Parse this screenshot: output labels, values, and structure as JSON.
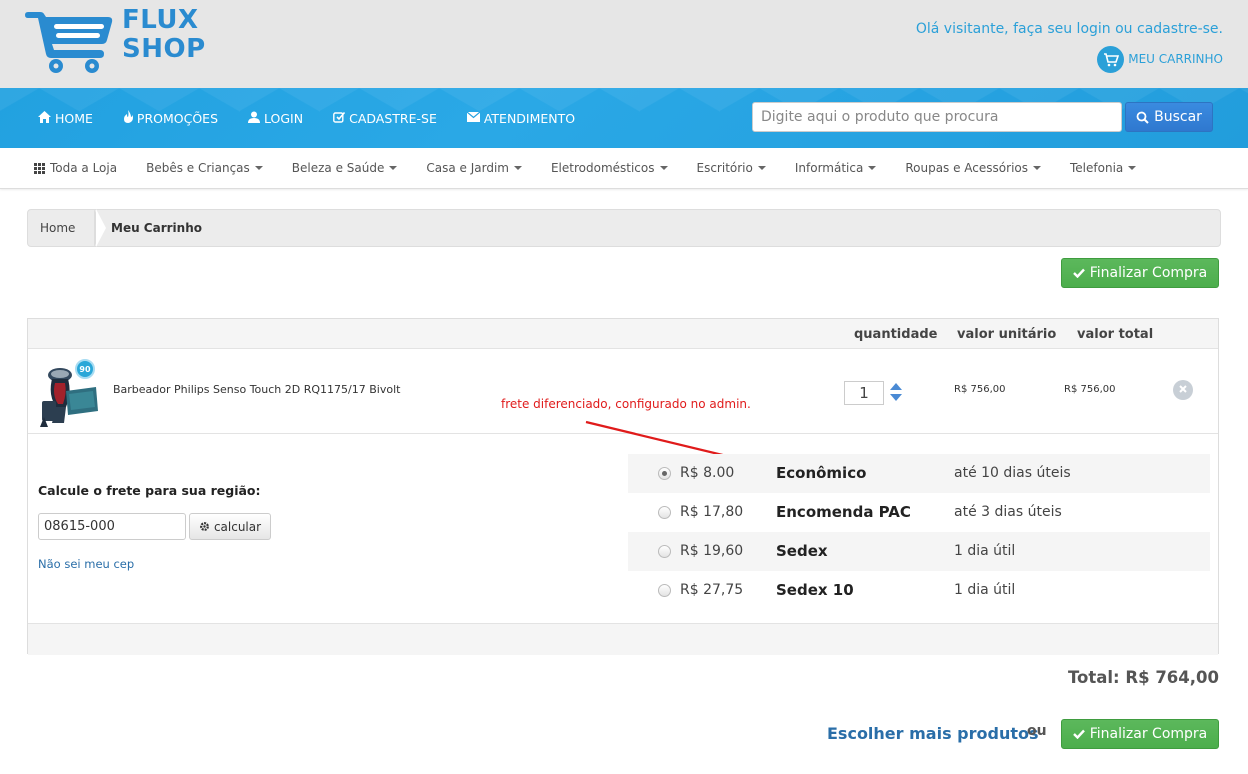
{
  "brand": {
    "line1": "FLUX",
    "line2": "SHOP",
    "color": "#2a8bd0"
  },
  "header": {
    "welcome": "Olá visitante, faça seu login ou cadastre-se.",
    "my_cart": "MEU CARRINHO"
  },
  "nav": {
    "items": [
      {
        "label": "HOME",
        "icon": "home-icon"
      },
      {
        "label": "PROMOÇÕES",
        "icon": "fire-icon"
      },
      {
        "label": "LOGIN",
        "icon": "user-icon"
      },
      {
        "label": "CADASTRE-SE",
        "icon": "edit-icon"
      },
      {
        "label": "ATENDIMENTO",
        "icon": "envelope-icon"
      }
    ],
    "search_placeholder": "Digite aqui o produto que procura",
    "search_button": "Buscar"
  },
  "categories": [
    "Toda a Loja",
    "Bebês e Crianças",
    "Beleza e Saúde",
    "Casa e Jardim",
    "Eletrodomésticos",
    "Escritório",
    "Informática",
    "Roupas e Acessórios",
    "Telefonia"
  ],
  "breadcrumb": {
    "home": "Home",
    "current": "Meu Carrinho"
  },
  "actions": {
    "checkout": "Finalizar Compra",
    "more_products": "Escolher mais produtos",
    "or": "ou"
  },
  "cart": {
    "columns": {
      "quantity": "quantidade",
      "unit_price": "valor unitário",
      "total_price": "valor total"
    },
    "product": {
      "name": "Barbeador Philips Senso Touch 2D RQ1175/17 Bivolt",
      "badge": "90",
      "quantity": "1",
      "unit_price": "R$ 756,00",
      "total_price": "R$ 756,00"
    },
    "annotation": "frete diferenciado, configurado no admin.",
    "shipping": {
      "label": "Calcule o frete para sua região:",
      "cep": "08615-000",
      "calc_button": "calcular",
      "no_cep": "Não sei meu cep",
      "options": [
        {
          "price": "R$ 8.00",
          "name": "Econômico",
          "time": "até 10 dias úteis",
          "selected": true
        },
        {
          "price": "R$ 17,80",
          "name": "Encomenda PAC",
          "time": "até 3 dias úteis",
          "selected": false
        },
        {
          "price": "R$ 19,60",
          "name": "Sedex",
          "time": "1 dia útil",
          "selected": false
        },
        {
          "price": "R$ 27,75",
          "name": "Sedex 10",
          "time": "1 dia útil",
          "selected": false
        }
      ]
    },
    "total": "Total: R$ 764,00"
  },
  "colors": {
    "accent": "#2ba0d8",
    "nav": "#22a1e0",
    "success": "#5cb85c",
    "annotation": "#e01b1b"
  }
}
